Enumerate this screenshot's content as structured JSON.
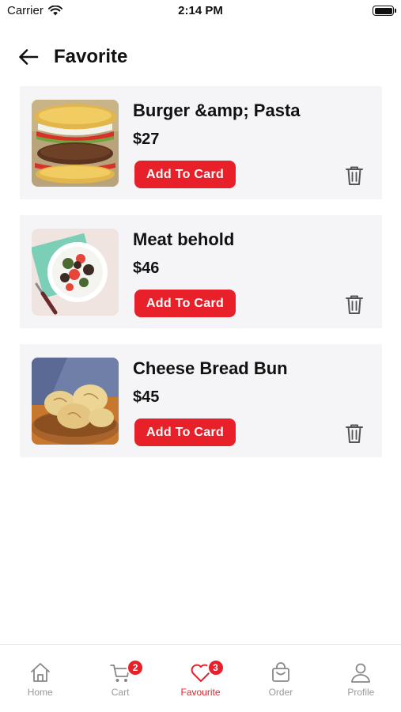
{
  "status_bar": {
    "carrier": "Carrier",
    "time": "2:14 PM"
  },
  "header": {
    "title": "Favorite"
  },
  "favorites": [
    {
      "name": "Burger &amp; Pasta",
      "price": "$27",
      "button_label": "Add To Card",
      "image": "burger-image"
    },
    {
      "name": "Meat behold",
      "price": "$46",
      "button_label": "Add To Card",
      "image": "salad-plate-image"
    },
    {
      "name": "Cheese Bread Bun",
      "price": "$45",
      "button_label": "Add To Card",
      "image": "bread-basket-image"
    }
  ],
  "tabbar": {
    "tabs": [
      {
        "label": "Home",
        "icon": "home-icon",
        "active": false
      },
      {
        "label": "Cart",
        "icon": "cart-icon",
        "active": false,
        "badge": "2"
      },
      {
        "label": "Favourite",
        "icon": "heart-icon",
        "active": true,
        "badge": "3"
      },
      {
        "label": "Order",
        "icon": "bag-icon",
        "active": false
      },
      {
        "label": "Profile",
        "icon": "user-icon",
        "active": false
      }
    ]
  },
  "colors": {
    "accent": "#e8202a",
    "card_background": "#f5f5f7",
    "inactive_tab": "#999999"
  }
}
